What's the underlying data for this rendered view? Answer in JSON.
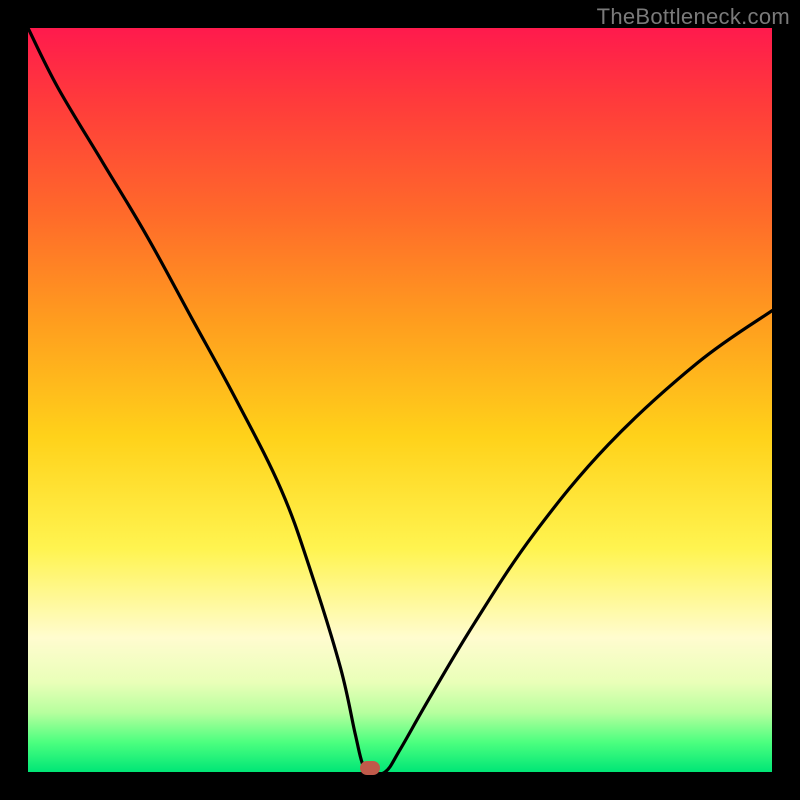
{
  "watermark": "TheBottleneck.com",
  "colors": {
    "frame": "#000000",
    "curve": "#000000",
    "marker": "#c05a4a",
    "gradient_top": "#ff1a4d",
    "gradient_bottom": "#00e676"
  },
  "chart_data": {
    "type": "line",
    "title": "",
    "xlabel": "",
    "ylabel": "",
    "xlim": [
      0,
      100
    ],
    "ylim": [
      0,
      100
    ],
    "grid": false,
    "legend": false,
    "series": [
      {
        "name": "bottleneck-curve",
        "x": [
          0,
          4,
          10,
          16,
          22,
          28,
          34,
          38,
          42,
          44,
          45,
          46,
          48,
          50,
          54,
          60,
          68,
          78,
          90,
          100
        ],
        "y": [
          100,
          92,
          82,
          72,
          61,
          50,
          38,
          27,
          14,
          5,
          1,
          0,
          0,
          3,
          10,
          20,
          32,
          44,
          55,
          62
        ]
      }
    ],
    "annotations": [
      {
        "name": "optimal-marker",
        "x": 46,
        "y": 0.5
      }
    ]
  }
}
